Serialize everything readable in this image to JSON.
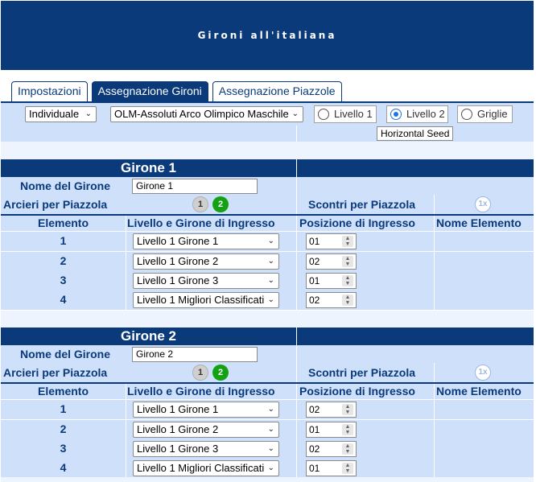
{
  "header": {
    "title": "Gironi all'italiana"
  },
  "tabs": [
    {
      "label": "Impostazioni",
      "active": false
    },
    {
      "label": "Assegnazione Gironi",
      "active": true
    },
    {
      "label": "Assegnazione Piazzole",
      "active": false
    }
  ],
  "filters": {
    "type_select": "Individuale",
    "event_select": "OLM-Assoluti Arco Olimpico Maschile",
    "radios": [
      {
        "label": "Livello 1",
        "checked": false
      },
      {
        "label": "Livello 2",
        "checked": true
      },
      {
        "label": "Griglie",
        "checked": false
      }
    ],
    "horizontal_seed_button": "Horizontal Seed"
  },
  "labels": {
    "nome_girone": "Nome del Girone",
    "arcieri_piazzola": "Arcieri per Piazzola",
    "scontri_piazzola": "Scontri per Piazzola",
    "col_elemento": "Elemento",
    "col_livello": "Livello e Girone di Ingresso",
    "col_posizione": "Posizione di Ingresso",
    "col_nome": "Nome Elemento"
  },
  "groups": [
    {
      "title": "Girone 1",
      "name_value": "Girone 1",
      "arcieri_options": [
        "1",
        "2"
      ],
      "arcieri_selected": "2",
      "scontri_badge": "1x",
      "rows": [
        {
          "num": "1",
          "livello": "Livello 1 Girone 1",
          "posizione": "01"
        },
        {
          "num": "2",
          "livello": "Livello 1 Girone 2",
          "posizione": "02"
        },
        {
          "num": "3",
          "livello": "Livello 1 Girone 3",
          "posizione": "01"
        },
        {
          "num": "4",
          "livello": "Livello 1 Migliori Classificati",
          "posizione": "02"
        }
      ]
    },
    {
      "title": "Girone 2",
      "name_value": "Girone 2",
      "arcieri_options": [
        "1",
        "2"
      ],
      "arcieri_selected": "2",
      "scontri_badge": "1x",
      "rows": [
        {
          "num": "1",
          "livello": "Livello 1 Girone 1",
          "posizione": "02"
        },
        {
          "num": "2",
          "livello": "Livello 1 Girone 2",
          "posizione": "01"
        },
        {
          "num": "3",
          "livello": "Livello 1 Girone 3",
          "posizione": "02"
        },
        {
          "num": "4",
          "livello": "Livello 1 Migliori Classificati",
          "posizione": "01"
        }
      ]
    }
  ],
  "colors": {
    "primary": "#0a3a7a",
    "row_bg": "#cfe0fb",
    "green": "#13a213"
  }
}
